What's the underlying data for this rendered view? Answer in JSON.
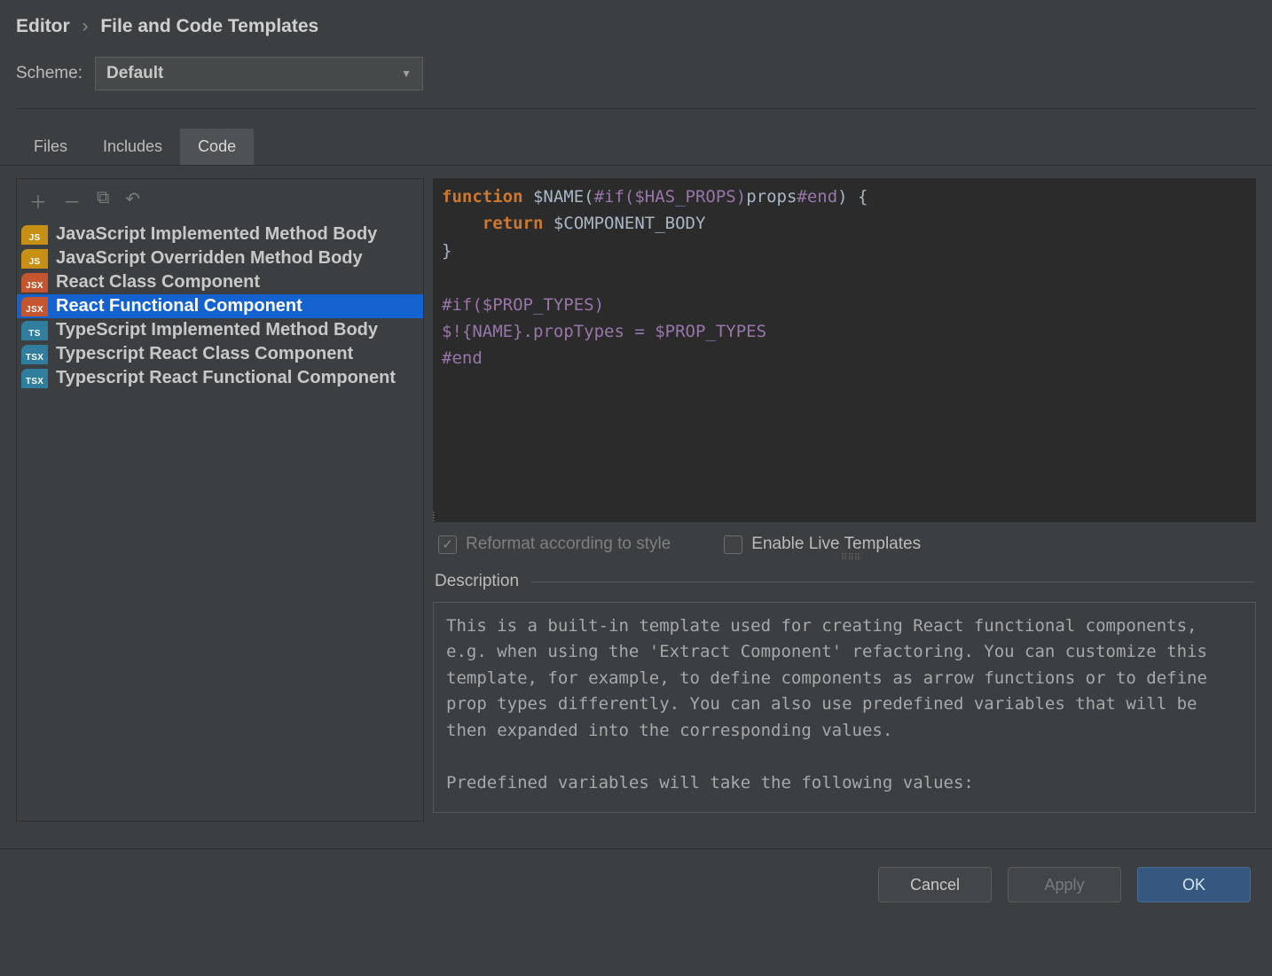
{
  "breadcrumb": {
    "parent": "Editor",
    "current": "File and Code Templates"
  },
  "scheme": {
    "label": "Scheme:",
    "value": "Default"
  },
  "tabs": [
    "Files",
    "Includes",
    "Code"
  ],
  "active_tab": 2,
  "templates": [
    {
      "badge": "JS",
      "cls": "js",
      "label": "JavaScript Implemented Method Body"
    },
    {
      "badge": "JS",
      "cls": "js",
      "label": "JavaScript Overridden Method Body"
    },
    {
      "badge": "JSX",
      "cls": "jsx",
      "label": "React Class Component"
    },
    {
      "badge": "JSX",
      "cls": "jsx",
      "label": "React Functional Component",
      "selected": true
    },
    {
      "badge": "TS",
      "cls": "ts",
      "label": "TypeScript Implemented Method Body"
    },
    {
      "badge": "TSX",
      "cls": "tsx",
      "label": "Typescript React Class Component"
    },
    {
      "badge": "TSX",
      "cls": "tsx",
      "label": "Typescript React Functional Component"
    }
  ],
  "code": {
    "l1a": "function",
    "l1b": " $NAME(",
    "l1c": "#if($HAS_PROPS)",
    "l1d": "props",
    "l1e": "#end",
    "l1f": ") {",
    "l2a": "    return",
    "l2b": " $COMPONENT_BODY",
    "l3": "}",
    "l5": "#if($PROP_TYPES)",
    "l6": "$!{NAME}.propTypes = $PROP_TYPES",
    "l7": "#end"
  },
  "checks": {
    "reformat": {
      "label": "Reformat according to style",
      "checked": true,
      "disabled": true
    },
    "live": {
      "label": "Enable Live Templates",
      "checked": false
    }
  },
  "description": {
    "heading": "Description",
    "p1": "This is a built-in template used for creating React functional components, e.g. when using the 'Extract Component' refactoring. You can customize this template, for example, to define components as arrow functions or to define prop types differently. You can also use predefined variables that will be then expanded into the corresponding values.",
    "p2": "Predefined variables will take the following values:"
  },
  "buttons": {
    "cancel": "Cancel",
    "apply": "Apply",
    "ok": "OK"
  }
}
